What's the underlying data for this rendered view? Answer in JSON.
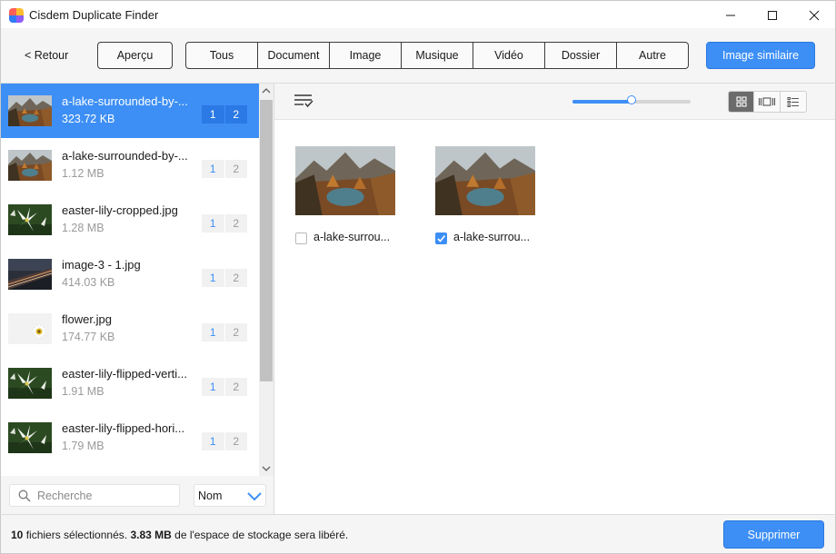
{
  "window": {
    "title": "Cisdem Duplicate Finder"
  },
  "toolbar": {
    "back_label": "< Retour",
    "preview_label": "Aperçu",
    "tabs": [
      {
        "label": "Tous"
      },
      {
        "label": "Document"
      },
      {
        "label": "Image"
      },
      {
        "label": "Musique"
      },
      {
        "label": "Vidéo"
      },
      {
        "label": "Dossier"
      },
      {
        "label": "Autre"
      }
    ],
    "similar_label": "Image similaire",
    "accent_color": "#3d8ff5"
  },
  "sidebar": {
    "items": [
      {
        "name": "a-lake-surrounded-by-...",
        "size": "323.72 KB",
        "badge1": "1",
        "badge2": "2",
        "thumb": "lake",
        "selected": true
      },
      {
        "name": "a-lake-surrounded-by-...",
        "size": "1.12 MB",
        "badge1": "1",
        "badge2": "2",
        "thumb": "lake",
        "selected": false
      },
      {
        "name": "easter-lily-cropped.jpg",
        "size": "1.28 MB",
        "badge1": "1",
        "badge2": "2",
        "thumb": "lily",
        "selected": false
      },
      {
        "name": "image-3 - 1.jpg",
        "size": "414.03 KB",
        "badge1": "1",
        "badge2": "2",
        "thumb": "road",
        "selected": false
      },
      {
        "name": "flower.jpg",
        "size": "174.77 KB",
        "badge1": "1",
        "badge2": "2",
        "thumb": "flower",
        "selected": false
      },
      {
        "name": "easter-lily-flipped-verti...",
        "size": "1.91 MB",
        "badge1": "1",
        "badge2": "2",
        "thumb": "lily",
        "selected": false
      },
      {
        "name": "easter-lily-flipped-hori...",
        "size": "1.79 MB",
        "badge1": "1",
        "badge2": "2",
        "thumb": "lily",
        "selected": false
      }
    ],
    "search_placeholder": "Recherche",
    "sort_value": "Nom"
  },
  "main": {
    "slider_value": 0.5,
    "view_modes": [
      "grid-view-icon",
      "filmstrip-view-icon",
      "list-view-icon"
    ],
    "active_view": 0,
    "cards": [
      {
        "name": "a-lake-surrou...",
        "checked": false
      },
      {
        "name": "a-lake-surrou...",
        "checked": true
      }
    ]
  },
  "footer": {
    "count": "10",
    "count_text": "fichiers sélectionnés.",
    "size": "3.83 MB",
    "size_text": "de l'espace de stockage sera libéré.",
    "delete_label": "Supprimer"
  }
}
